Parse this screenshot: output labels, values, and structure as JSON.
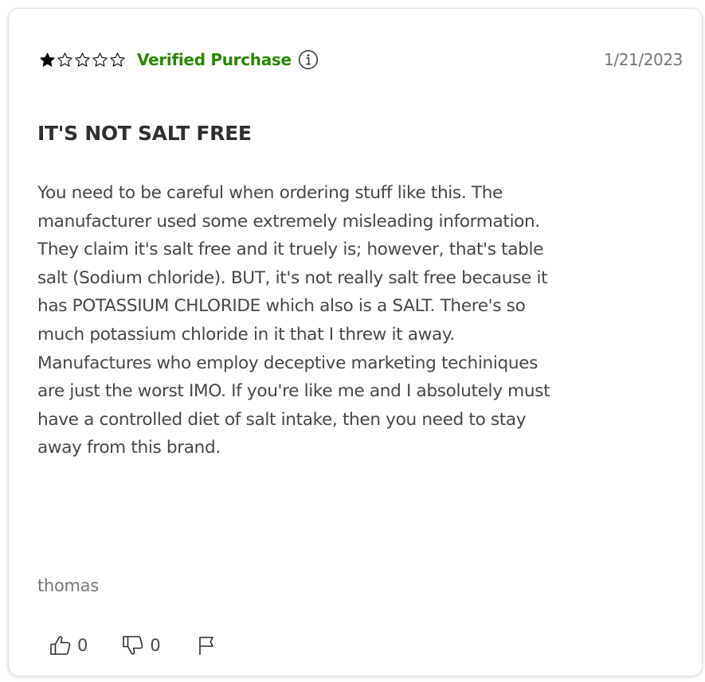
{
  "review": {
    "rating": 1,
    "rating_max": 5,
    "verified_label": "Verified Purchase",
    "date": "1/21/2023",
    "title": "IT'S NOT SALT FREE",
    "body_lines": [
      "You need to be careful when ordering stuff like this. The",
      "manufacturer used some extremely misleading information.",
      "They claim it's salt free and it truely is; however, that's table",
      "salt (Sodium chloride). BUT, it's not really salt free because it",
      "has POTASSIUM CHLORIDE which also is a SALT. There's so",
      "much potassium chloride in it that I threw it away.",
      "Manufactures who employ deceptive marketing techiniques",
      "are just the worst IMO. If you're like me and I absolutely must",
      "have a controlled diet of salt intake, then you need to stay",
      "away from this brand."
    ],
    "author": "thomas",
    "helpful_count": "0",
    "unhelpful_count": "0"
  },
  "colors": {
    "verified": "#2a8703",
    "date": "#74767c",
    "title": "#2e2f32",
    "body": "#46474a",
    "star": "#000000"
  },
  "icons": {
    "star_filled": "star-filled-icon",
    "star_empty": "star-outline-icon",
    "info": "info-circle-icon",
    "thumbs_up": "thumbs-up-icon",
    "thumbs_down": "thumbs-down-icon",
    "flag": "flag-icon"
  }
}
